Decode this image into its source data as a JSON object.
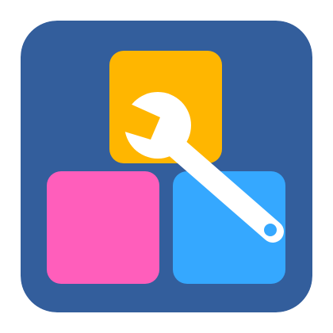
{
  "icon": {
    "name": "toolbox-wrench-app-icon",
    "colors": {
      "background": "#335E9C",
      "block_top": "#FFB600",
      "block_left": "#FF5EBB",
      "block_right": "#35A8FF",
      "wrench": "#FFFFFF",
      "wrench_hole": "#35A8FF"
    }
  }
}
